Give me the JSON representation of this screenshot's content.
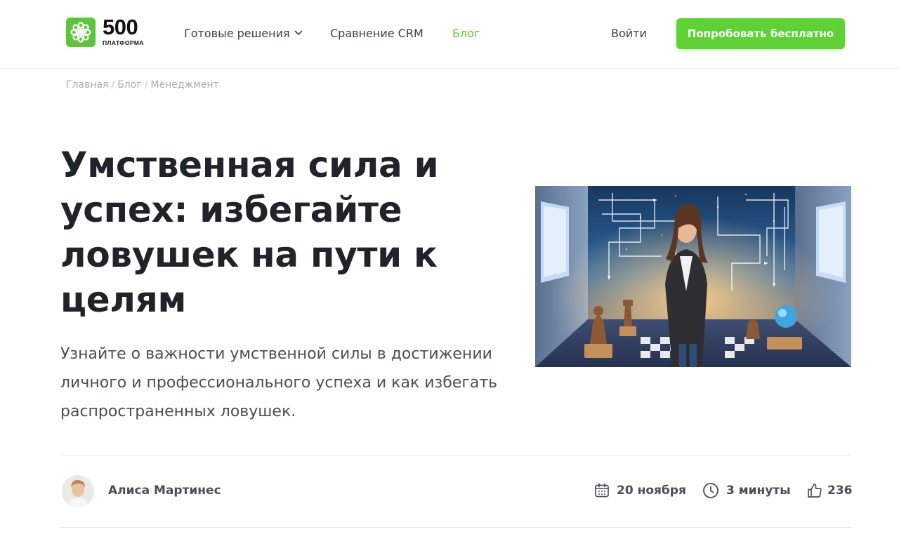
{
  "header": {
    "logo": {
      "number": "500",
      "subtitle": "ПЛАТФОРМА"
    },
    "nav": [
      {
        "label": "Готовые решения",
        "has_dropdown": true,
        "active": false
      },
      {
        "label": "Сравнение CRM",
        "has_dropdown": false,
        "active": false
      },
      {
        "label": "Блог",
        "has_dropdown": false,
        "active": true
      }
    ],
    "login_label": "Войти",
    "cta_label": "Попробовать бесплатно"
  },
  "breadcrumb": {
    "items": [
      "Главная",
      "Блог",
      "Менеджмент"
    ],
    "separator": "/"
  },
  "article": {
    "title": "Умственная сила и успех: избегайте ловушек на пути к целям",
    "subtitle": "Узнайте о важности умственной силы в достижении личного и профессионального успеха и как избегать распространенных ловушек.",
    "author": "Алиса Мартинес",
    "date": "20 ноября",
    "read_time": "3 минуты",
    "likes": "236"
  },
  "icons": {
    "logo": "flower-logo-icon",
    "dropdown": "chevron-down-icon",
    "date": "calendar-icon",
    "time": "clock-icon",
    "likes": "thumbs-up-icon"
  },
  "colors": {
    "accent": "#5cc63a",
    "cta": "#5ed134",
    "title": "#20232a",
    "muted": "#a7adb5"
  }
}
